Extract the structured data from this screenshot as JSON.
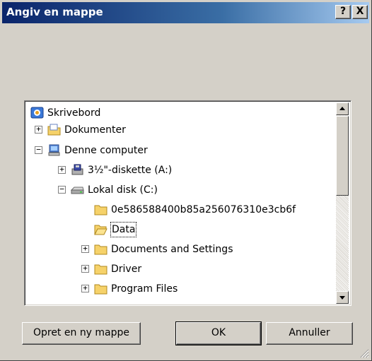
{
  "window": {
    "title": "Angiv en mappe",
    "help_label": "?",
    "close_label": "X"
  },
  "tree": {
    "items": [
      {
        "label": "Skrivebord",
        "icon": "desktop-icon"
      },
      {
        "label": "Dokumenter",
        "icon": "documents-folder-icon",
        "expander": "+"
      },
      {
        "label": "Denne computer",
        "icon": "computer-icon",
        "expander": "−"
      },
      {
        "label": "3½\"-diskette (A:)",
        "icon": "floppy-drive-icon",
        "expander": "+"
      },
      {
        "label": "Lokal disk (C:)",
        "icon": "hard-drive-icon",
        "expander": "−"
      },
      {
        "label": "0e586588400b85a256076310e3cb6f",
        "icon": "folder-icon"
      },
      {
        "label": "Data",
        "icon": "open-folder-icon",
        "selected": true
      },
      {
        "label": "Documents and Settings",
        "icon": "folder-icon",
        "expander": "+"
      },
      {
        "label": "Driver",
        "icon": "folder-icon",
        "expander": "+"
      },
      {
        "label": "Program Files",
        "icon": "folder-icon",
        "expander": "+"
      }
    ]
  },
  "buttons": {
    "new_folder": "Opret en ny mappe",
    "ok": "OK",
    "cancel": "Annuller"
  },
  "colors": {
    "titlebar_start": "#0a246a",
    "titlebar_end": "#a6caf0",
    "face": "#d4d0c8",
    "folder": "#f6d26a"
  }
}
